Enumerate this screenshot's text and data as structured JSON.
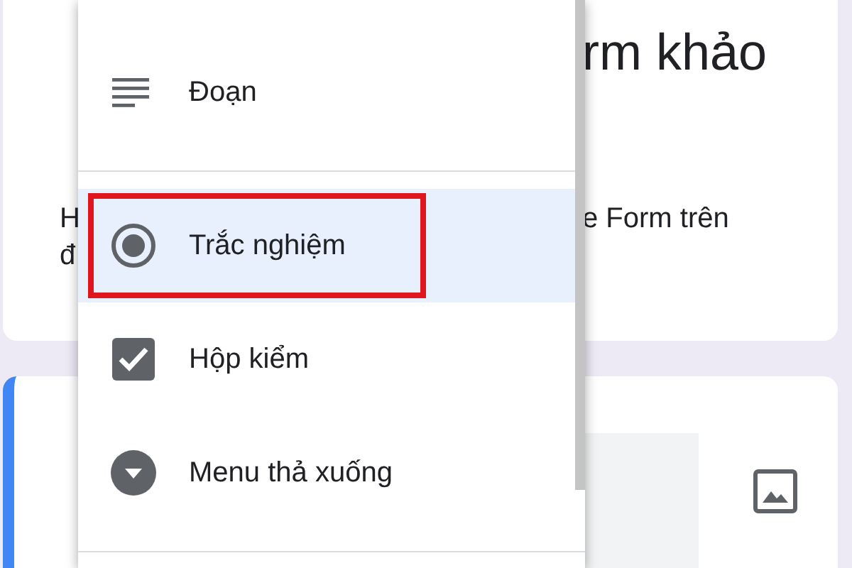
{
  "title_card": {
    "title_right": "rm khảo",
    "desc_left": [
      "H",
      "đ"
    ],
    "desc_right": "e Form trên"
  },
  "menu": {
    "items": [
      {
        "label": "Đoạn",
        "kind": "paragraph",
        "selected": false,
        "annotated": false
      },
      {
        "kind": "divider"
      },
      {
        "label": "Trắc nghiệm",
        "kind": "radio",
        "selected": true,
        "annotated": true
      },
      {
        "label": "Hộp kiểm",
        "kind": "checkbox",
        "selected": false,
        "annotated": false
      },
      {
        "label": "Menu thả xuống",
        "kind": "dropdown",
        "selected": false,
        "annotated": false
      },
      {
        "kind": "divider"
      }
    ]
  }
}
